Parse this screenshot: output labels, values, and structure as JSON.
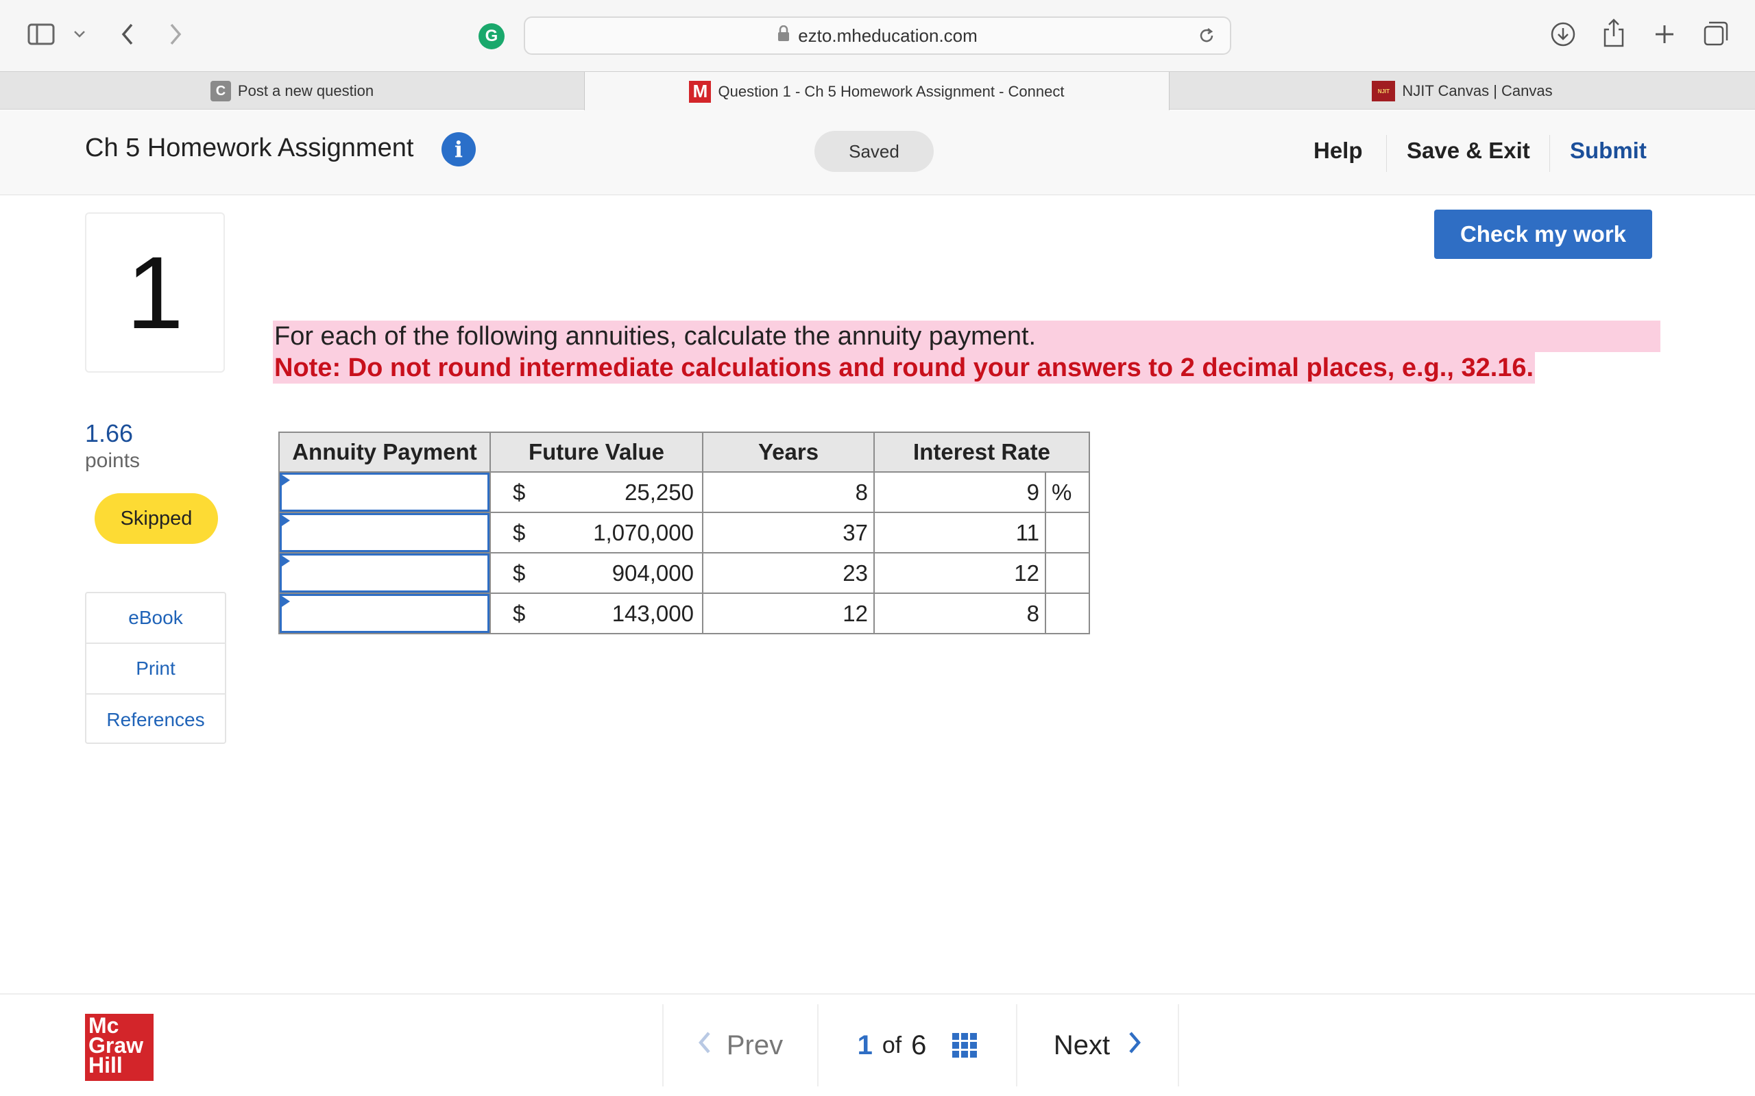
{
  "browser": {
    "url": "ezto.mheducation.com",
    "tabs": [
      {
        "label": "Post a new question",
        "favicon": "C"
      },
      {
        "label": "Question 1 - Ch 5 Homework Assignment - Connect",
        "favicon": "M"
      },
      {
        "label": "NJIT Canvas | Canvas",
        "favicon": "NJIT"
      }
    ]
  },
  "header": {
    "title": "Ch 5 Homework Assignment",
    "status": "Saved",
    "help": "Help",
    "save_exit": "Save & Exit",
    "submit": "Submit"
  },
  "question": {
    "number": "1",
    "points": "1.66",
    "points_label": "points",
    "status_badge": "Skipped",
    "check_button": "Check my work",
    "prompt": "For each of the following annuities, calculate the annuity payment.",
    "note": "Note: Do not round intermediate calculations and round your answers to 2 decimal places, e.g., 32.16."
  },
  "side_links": [
    "eBook",
    "Print",
    "References"
  ],
  "table": {
    "headers": [
      "Annuity Payment",
      "Future Value",
      "Years",
      "Interest Rate"
    ],
    "currency": "$",
    "percent": "%",
    "rows": [
      {
        "payment": "",
        "future_value": "25,250",
        "years": "8",
        "rate": "9",
        "show_percent": true
      },
      {
        "payment": "",
        "future_value": "1,070,000",
        "years": "37",
        "rate": "11",
        "show_percent": false
      },
      {
        "payment": "",
        "future_value": "904,000",
        "years": "23",
        "rate": "12",
        "show_percent": false
      },
      {
        "payment": "",
        "future_value": "143,000",
        "years": "12",
        "rate": "8",
        "show_percent": false
      }
    ]
  },
  "footer": {
    "logo": [
      "Mc",
      "Graw",
      "Hill"
    ],
    "prev": "Prev",
    "current_page": "1",
    "of_label": "of",
    "total_pages": "6",
    "next": "Next"
  },
  "colors": {
    "brand_blue": "#2f6ec4",
    "note_red": "#c8101c",
    "highlight_pink": "#fbcfe0",
    "skipped_yellow": "#fddb34",
    "mh_red": "#d3252a"
  }
}
